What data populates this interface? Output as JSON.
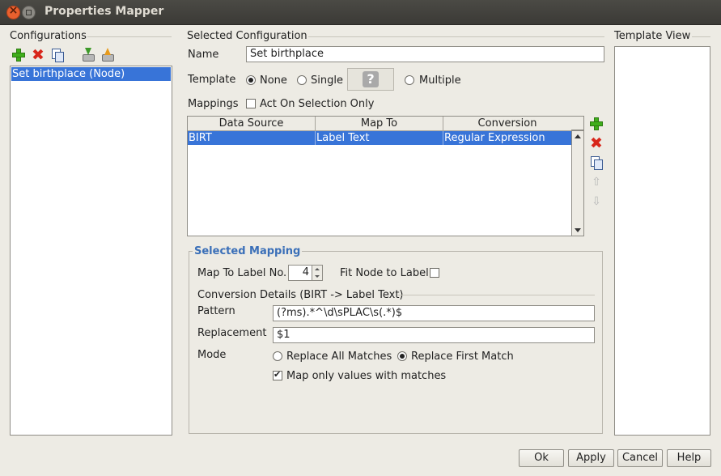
{
  "window": {
    "title": "Properties Mapper"
  },
  "configurations": {
    "label": "Configurations",
    "items": [
      "Set birthplace (Node)"
    ]
  },
  "selected_configuration": {
    "label": "Selected Configuration",
    "name_label": "Name",
    "name_value": "Set birthplace",
    "template_label": "Template",
    "template_options": [
      "None",
      "Single",
      "Multiple"
    ],
    "template_selected": "None",
    "mappings_label": "Mappings",
    "act_on_selection_label": "Act On Selection Only",
    "act_on_selection_checked": false
  },
  "mappings_table": {
    "columns": [
      "Data Source",
      "Map To",
      "Conversion"
    ],
    "rows": [
      [
        "BIRT",
        "Label Text",
        "Regular Expression"
      ]
    ]
  },
  "selected_mapping": {
    "title": "Selected Mapping",
    "map_to_label": "Map To Label No.",
    "label_no": "4",
    "fit_node_label": "Fit Node to Label",
    "fit_node_checked": false,
    "conversion_details_label": "Conversion Details (BIRT -> Label Text)",
    "pattern_label": "Pattern",
    "pattern_value": "(?ms).*^\\d\\sPLAC\\s(.*)$",
    "replacement_label": "Replacement",
    "replacement_value": "$1",
    "mode_label": "Mode",
    "mode_options": [
      "Replace All Matches",
      "Replace First Match"
    ],
    "mode_selected": "Replace First Match",
    "map_only_label": "Map only values with matches",
    "map_only_checked": true
  },
  "template_view": {
    "label": "Template View"
  },
  "footer": {
    "ok": "Ok",
    "apply": "Apply",
    "cancel": "Cancel",
    "help": "Help"
  },
  "colors": {
    "selection": "#3874d8",
    "accent_title": "#3a6fb8",
    "background": "#edebe4"
  }
}
